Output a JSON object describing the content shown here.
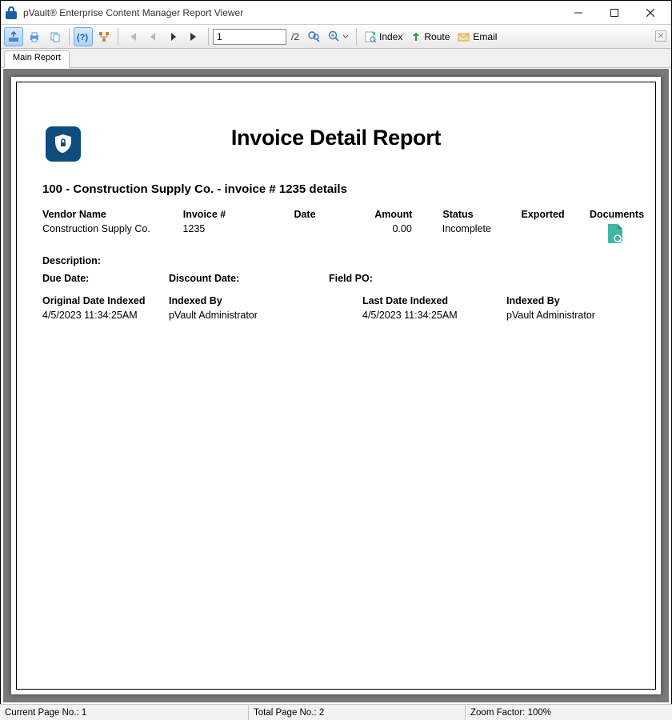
{
  "window": {
    "title": "pVault® Enterprise Content Manager Report Viewer"
  },
  "toolbar": {
    "page_input": "1",
    "page_total": "/2",
    "index_label": "Index",
    "route_label": "Route",
    "email_label": "Email"
  },
  "tabs": {
    "main": "Main Report"
  },
  "report": {
    "title": "Invoice Detail Report",
    "section_header": "100  -  Construction Supply Co.  -   invoice # 1235 details",
    "columns": {
      "vendor_name": "Vendor Name",
      "invoice_no": "Invoice #",
      "date": "Date",
      "amount": "Amount",
      "status": "Status",
      "exported": "Exported",
      "documents": "Documents",
      "description": "Description:",
      "due_date": "Due Date:",
      "discount_date": "Discount Date:",
      "field_po": "Field PO:",
      "orig_date_indexed": "Original Date Indexed",
      "indexed_by": "Indexed By",
      "last_date_indexed": "Last Date Indexed",
      "indexed_by2": "Indexed By"
    },
    "values": {
      "vendor_name": "Construction Supply Co.",
      "invoice_no": "1235",
      "date": "",
      "amount": "0.00",
      "status": "Incomplete",
      "exported": "",
      "orig_date_indexed": "4/5/2023  11:34:25AM",
      "indexed_by": "pVault Administrator",
      "last_date_indexed": "4/5/2023  11:34:25AM",
      "indexed_by2": "pVault Administrator"
    }
  },
  "status": {
    "current_page": "Current Page No.: 1",
    "total_page": "Total Page No.: 2",
    "zoom": "Zoom Factor: 100%"
  }
}
